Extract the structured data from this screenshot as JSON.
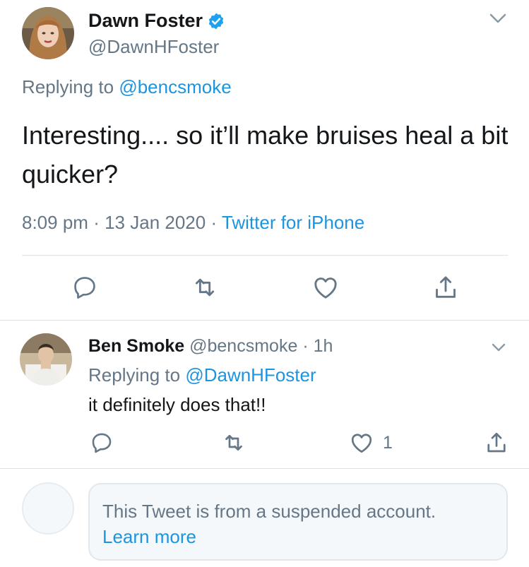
{
  "main_tweet": {
    "author_name": "Dawn Foster",
    "author_handle": "@DawnHFoster",
    "replying_prefix": "Replying to ",
    "replying_to": "@bencsmoke",
    "text": "Interesting.... so it’ll make bruises heal a bit quicker?",
    "time": "8:09 pm",
    "date": "13 Jan 2020",
    "separator": "·",
    "source": "Twitter for iPhone"
  },
  "reply": {
    "author_name": "Ben Smoke",
    "author_handle": "@bencsmoke",
    "separator": "·",
    "age": "1h",
    "replying_prefix": "Replying to ",
    "replying_to": "@DawnHFoster",
    "text": "it definitely does that!!",
    "like_count": "1"
  },
  "suspended_notice": {
    "message": "This Tweet is from a suspended account.",
    "link": "Learn more"
  },
  "icons": {
    "verified": "verified-badge-icon",
    "reply": "reply-icon",
    "retweet": "retweet-icon",
    "like": "heart-icon",
    "share": "share-icon",
    "more": "chevron-down-icon"
  },
  "colors": {
    "link_blue": "#1b95e0",
    "secondary_text": "#657786",
    "divider": "#dde2e6"
  }
}
